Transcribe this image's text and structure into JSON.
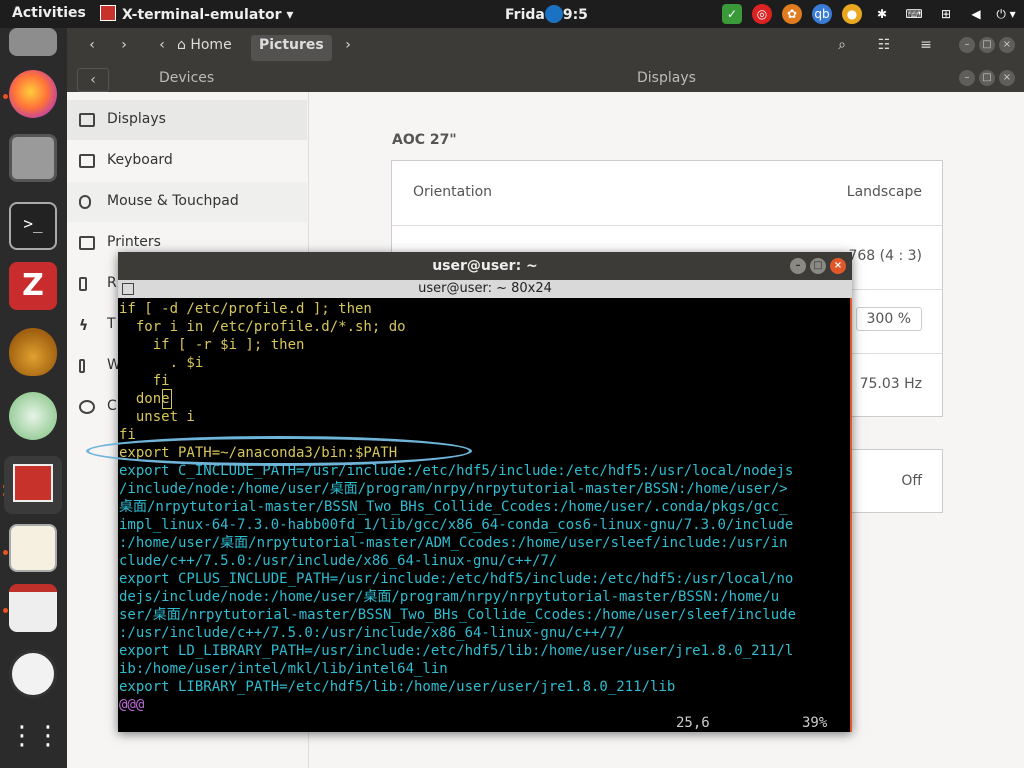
{
  "topbar": {
    "activities": "Activities",
    "app_name": "X-terminal-emulator",
    "clock": "Frida",
    "clock_time": "9:5"
  },
  "files": {
    "home_label": "Home",
    "pictures_label": "Pictures"
  },
  "settings": {
    "devices_title": "Devices",
    "panel_title": "Displays",
    "sidebar": [
      "Displays",
      "Keyboard",
      "Mouse & Touchpad",
      "Printers",
      "R",
      "T",
      "W",
      "C"
    ],
    "monitor_name": "AOC 27\"",
    "rows": [
      {
        "label": "Orientation",
        "value": "Landscape"
      },
      {
        "label": "",
        "value": "768 (4 : 3)"
      },
      {
        "label": "",
        "value": "300 %"
      },
      {
        "label": "",
        "value": "75.03 Hz"
      }
    ],
    "night_light_value": "Off"
  },
  "terminal": {
    "title": "user@user: ~",
    "subtitle": "user@user: ~ 80x24",
    "lines": [
      "if [ -d /etc/profile.d ]; then",
      "  for i in /etc/profile.d/*.sh; do",
      "    if [ -r $i ]; then",
      "      . $i",
      "    fi",
      "  done",
      "  unset i",
      "fi",
      "export PATH=~/anaconda3/bin:$PATH",
      "export C_INCLUDE_PATH=/usr/include:/etc/hdf5/include:/etc/hdf5:/usr/local/nodejs",
      "/include/node:/home/user/桌面/program/nrpy/nrpytutorial-master/BSSN:/home/user/>",
      "桌面/nrpytutorial-master/BSSN_Two_BHs_Collide_Ccodes:/home/user/.conda/pkgs/gcc_",
      "impl_linux-64-7.3.0-habb00fd_1/lib/gcc/x86_64-conda_cos6-linux-gnu/7.3.0/include",
      ":/home/user/桌面/nrpytutorial-master/ADM_Ccodes:/home/user/sleef/include:/usr/in",
      "clude/c++/7.5.0:/usr/include/x86_64-linux-gnu/c++/7/",
      "export CPLUS_INCLUDE_PATH=/usr/include:/etc/hdf5/include:/etc/hdf5:/usr/local/no",
      "dejs/include/node:/home/user/桌面/program/nrpy/nrpytutorial-master/BSSN:/home/u",
      "ser/桌面/nrpytutorial-master/BSSN_Two_BHs_Collide_Ccodes:/home/user/sleef/include",
      ":/usr/include/c++/7.5.0:/usr/include/x86_64-linux-gnu/c++/7/",
      "export LD_LIBRARY_PATH=/usr/include:/etc/hdf5/lib:/home/user/user/jre1.8.0_211/l",
      "ib:/home/user/intel/mkl/lib/intel64_lin",
      "export LIBRARY_PATH=/etc/hdf5/lib:/home/user/user/jre1.8.0_211/lib",
      "@@@"
    ],
    "status_pos": "25,6",
    "status_pct": "39%"
  }
}
